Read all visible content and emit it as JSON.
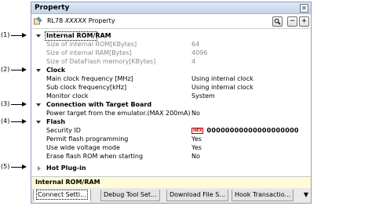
{
  "callouts": [
    "(1)",
    "(2)",
    "(3)",
    "(4)",
    "(5)"
  ],
  "panel": {
    "title": "Property"
  },
  "toolbar": {
    "prefix": "RL78",
    "device": "XXXXX",
    "suffix": "Property",
    "search_icon": "magnifier-icon",
    "collapse_label": "−",
    "expand_label": "+"
  },
  "rows": {
    "rom_ram": {
      "name": "Internal ROM/RAM"
    },
    "rom_size": {
      "name": "Size of internal ROM[KBytes]",
      "value": "64"
    },
    "ram_size": {
      "name": "Size of internal RAM[Bytes]",
      "value": "4096"
    },
    "flash_size": {
      "name": "Size of DataFlash memory[KBytes]",
      "value": "4"
    },
    "clock": {
      "name": "Clock"
    },
    "main_clock": {
      "name": "Main clock frequency [MHz]",
      "value": "Using internal clock"
    },
    "sub_clock": {
      "name": "Sub clock frequency[kHz]",
      "value": "Using internal clock"
    },
    "monitor_clock": {
      "name": "Monitor clock",
      "value": "System"
    },
    "connection": {
      "name": "Connection with Target Board"
    },
    "power_target": {
      "name": "Power target from the emulator.(MAX 200mA)",
      "value": "No"
    },
    "flash": {
      "name": "Flash"
    },
    "security_id": {
      "name": "Security ID",
      "badge": "HEX",
      "value": "00000000000000000000"
    },
    "permit_flash": {
      "name": "Permit flash programming",
      "value": "Yes"
    },
    "wide_voltage": {
      "name": "Use wide voltage mode",
      "value": "Yes"
    },
    "erase_flash": {
      "name": "Erase flash ROM when starting",
      "value": "No"
    },
    "hotplug": {
      "name": "Hot Plug-in"
    }
  },
  "description": "Internal ROM/RAM",
  "tabs": [
    "Connect Setti...",
    "Debug Tool Set...",
    "Download File S...",
    "Hook Transactio..."
  ],
  "tab_menu": "▼",
  "colors": {
    "titlebar": "#c4d3e8",
    "description_bg": "#fffbd6",
    "hex_badge": "#c00000"
  }
}
